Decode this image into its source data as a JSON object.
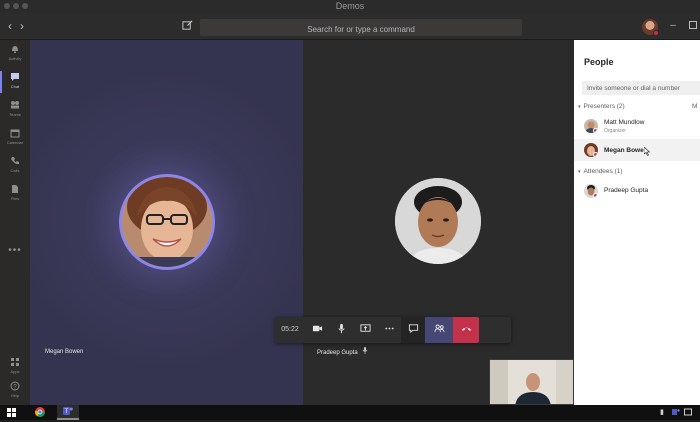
{
  "window": {
    "title": "Demos"
  },
  "header": {
    "search_placeholder": "Search for or type a command"
  },
  "rail": {
    "items": [
      {
        "label": "Activity",
        "icon": "bell-icon"
      },
      {
        "label": "Chat",
        "icon": "chat-icon"
      },
      {
        "label": "Teams",
        "icon": "teams-icon"
      },
      {
        "label": "Calendar",
        "icon": "calendar-icon"
      },
      {
        "label": "Calls",
        "icon": "phone-icon"
      },
      {
        "label": "Files",
        "icon": "files-icon"
      }
    ],
    "more": "•••",
    "bottom": [
      {
        "label": "Apps",
        "icon": "apps-icon"
      },
      {
        "label": "Help",
        "icon": "help-icon"
      }
    ]
  },
  "stage": {
    "left_participant": "Megan Bowen",
    "right_participant": "Pradeep Gupta"
  },
  "call_controls": {
    "timer": "05:22",
    "buttons": [
      "camera",
      "microphone",
      "share-screen",
      "more-options",
      "chat",
      "participants",
      "hang-up"
    ]
  },
  "people": {
    "title": "People",
    "invite_placeholder": "Invite someone or dial a number",
    "presenters_label": "Presenters",
    "presenters_count": "(2)",
    "mute_all_label": "M",
    "presenters": [
      {
        "name": "Matt Mundlow",
        "role": "Organizer"
      },
      {
        "name": "Megan Bowe"
      }
    ],
    "attendees_label": "Attendees",
    "attendees_count": "(1)",
    "attendees": [
      {
        "name": "Pradeep Gupta"
      }
    ]
  },
  "colors": {
    "accent": "#7b83eb",
    "hangup": "#c4314b",
    "participants_button": "#464775",
    "panel_bg": "#ffffff"
  }
}
